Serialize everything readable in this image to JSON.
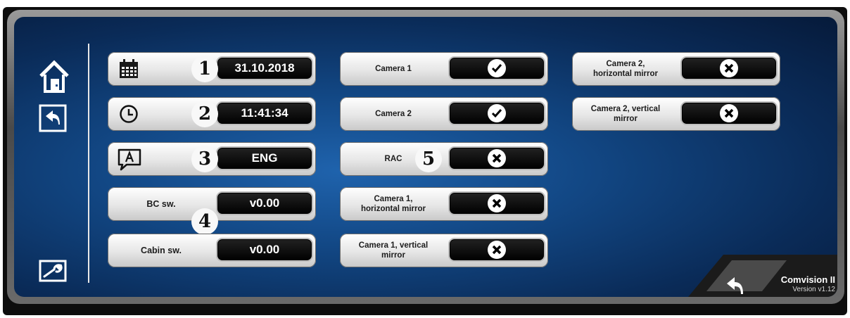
{
  "settings": {
    "date": {
      "icon": "calendar-icon",
      "value": "31.10.2018",
      "marker": "1"
    },
    "time": {
      "icon": "clock-icon",
      "value": "11:41:34",
      "marker": "2"
    },
    "language": {
      "icon": "language-icon",
      "value": "ENG",
      "marker": "3"
    },
    "bc_sw": {
      "label": "BC sw.",
      "value": "v0.00"
    },
    "cabin_sw": {
      "label": "Cabin sw.",
      "value": "v0.00"
    },
    "software_marker": "4"
  },
  "cameras": [
    {
      "label": "Camera 1",
      "state": "checked",
      "icon": "check-icon"
    },
    {
      "label": "Camera 2",
      "state": "checked",
      "icon": "check-icon"
    },
    {
      "label": "RAC",
      "state": "unchecked",
      "icon": "x-icon",
      "marker": "5"
    },
    {
      "label": "Camera 1,\nhorizontal mirror",
      "state": "unchecked",
      "icon": "x-icon"
    },
    {
      "label": "Camera 1, vertical\nmirror",
      "state": "unchecked",
      "icon": "x-icon"
    },
    {
      "label": "Camera 2,\nhorizontal mirror",
      "state": "unchecked",
      "icon": "x-icon"
    },
    {
      "label": "Camera 2, vertical\nmirror",
      "state": "unchecked",
      "icon": "x-icon"
    }
  ],
  "sidebar": {
    "home": "home-icon",
    "back": "back-icon",
    "settings": "wrench-icon"
  },
  "footer": {
    "back": "back-icon",
    "app_name": "Comvision II",
    "version": "Version v1.12"
  },
  "colors": {
    "accent": "#124784",
    "value_bg": "#000000",
    "pill_bg": "#e6e6e6"
  }
}
